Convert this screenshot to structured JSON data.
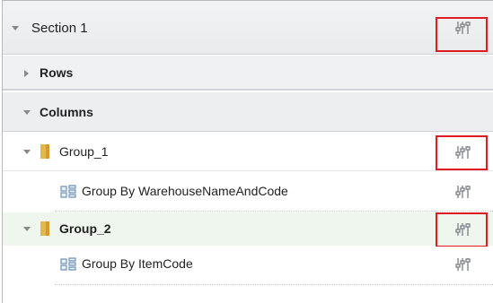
{
  "section": {
    "label": "Section 1"
  },
  "rows": {
    "label": "Rows"
  },
  "columns": {
    "label": "Columns"
  },
  "groups": [
    {
      "label": "Group_1",
      "child": "Group By WarehouseNameAndCode"
    },
    {
      "label": "Group_2",
      "child": "Group By ItemCode"
    }
  ],
  "colors": {
    "highlight": "#e01b24",
    "group2_bg": "#eef6ee"
  },
  "icons": {
    "settings": "settings-sliders-icon",
    "folder": "folder-icon",
    "group_by": "group-by-icon"
  }
}
